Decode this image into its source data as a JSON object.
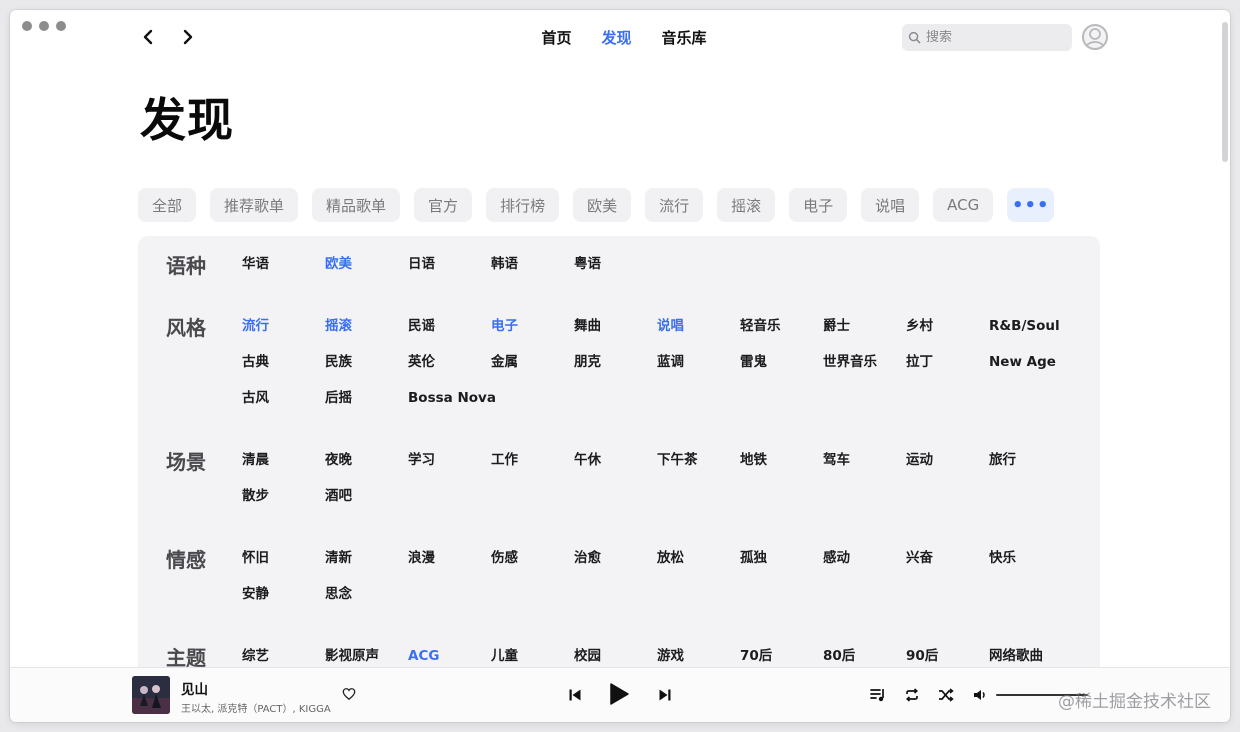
{
  "nav": {
    "tabs": [
      {
        "label": "首页",
        "active": false
      },
      {
        "label": "发现",
        "active": true
      },
      {
        "label": "音乐库",
        "active": false
      }
    ],
    "search_placeholder": "搜索"
  },
  "page": {
    "title": "发现"
  },
  "chips": [
    "全部",
    "推荐歌单",
    "精品歌单",
    "官方",
    "排行榜",
    "欧美",
    "流行",
    "摇滚",
    "电子",
    "说唱",
    "ACG"
  ],
  "chips_more_label": "•••",
  "categories": [
    {
      "name": "语种",
      "tags": [
        {
          "label": "华语"
        },
        {
          "label": "欧美",
          "active": true
        },
        {
          "label": "日语"
        },
        {
          "label": "韩语"
        },
        {
          "label": "粤语"
        }
      ]
    },
    {
      "name": "风格",
      "tags": [
        {
          "label": "流行",
          "active": true
        },
        {
          "label": "摇滚",
          "active": true
        },
        {
          "label": "民谣"
        },
        {
          "label": "电子",
          "active": true
        },
        {
          "label": "舞曲"
        },
        {
          "label": "说唱",
          "active": true
        },
        {
          "label": "轻音乐"
        },
        {
          "label": "爵士"
        },
        {
          "label": "乡村"
        },
        {
          "label": "R&B/Soul"
        },
        {
          "label": "古典"
        },
        {
          "label": "民族"
        },
        {
          "label": "英伦"
        },
        {
          "label": "金属"
        },
        {
          "label": "朋克"
        },
        {
          "label": "蓝调"
        },
        {
          "label": "雷鬼"
        },
        {
          "label": "世界音乐"
        },
        {
          "label": "拉丁"
        },
        {
          "label": "New Age"
        },
        {
          "label": "古风"
        },
        {
          "label": "后摇"
        },
        {
          "label": "Bossa Nova"
        }
      ]
    },
    {
      "name": "场景",
      "tags": [
        {
          "label": "清晨"
        },
        {
          "label": "夜晚"
        },
        {
          "label": "学习"
        },
        {
          "label": "工作"
        },
        {
          "label": "午休"
        },
        {
          "label": "下午茶"
        },
        {
          "label": "地铁"
        },
        {
          "label": "驾车"
        },
        {
          "label": "运动"
        },
        {
          "label": "旅行"
        },
        {
          "label": "散步"
        },
        {
          "label": "酒吧"
        }
      ]
    },
    {
      "name": "情感",
      "tags": [
        {
          "label": "怀旧"
        },
        {
          "label": "清新"
        },
        {
          "label": "浪漫"
        },
        {
          "label": "伤感"
        },
        {
          "label": "治愈"
        },
        {
          "label": "放松"
        },
        {
          "label": "孤独"
        },
        {
          "label": "感动"
        },
        {
          "label": "兴奋"
        },
        {
          "label": "快乐"
        },
        {
          "label": "安静"
        },
        {
          "label": "思念"
        }
      ]
    },
    {
      "name": "主题",
      "tags": [
        {
          "label": "综艺"
        },
        {
          "label": "影视原声"
        },
        {
          "label": "ACG",
          "active": true
        },
        {
          "label": "儿童"
        },
        {
          "label": "校园"
        },
        {
          "label": "游戏"
        },
        {
          "label": "70后"
        },
        {
          "label": "80后"
        },
        {
          "label": "90后"
        },
        {
          "label": "网络歌曲"
        }
      ]
    }
  ],
  "player": {
    "title": "见山",
    "artist": "王以太, 派克特（PACT）, KIGGA"
  },
  "watermark": "@稀土掘金技术社区",
  "accent_color": "#3a6ff0"
}
